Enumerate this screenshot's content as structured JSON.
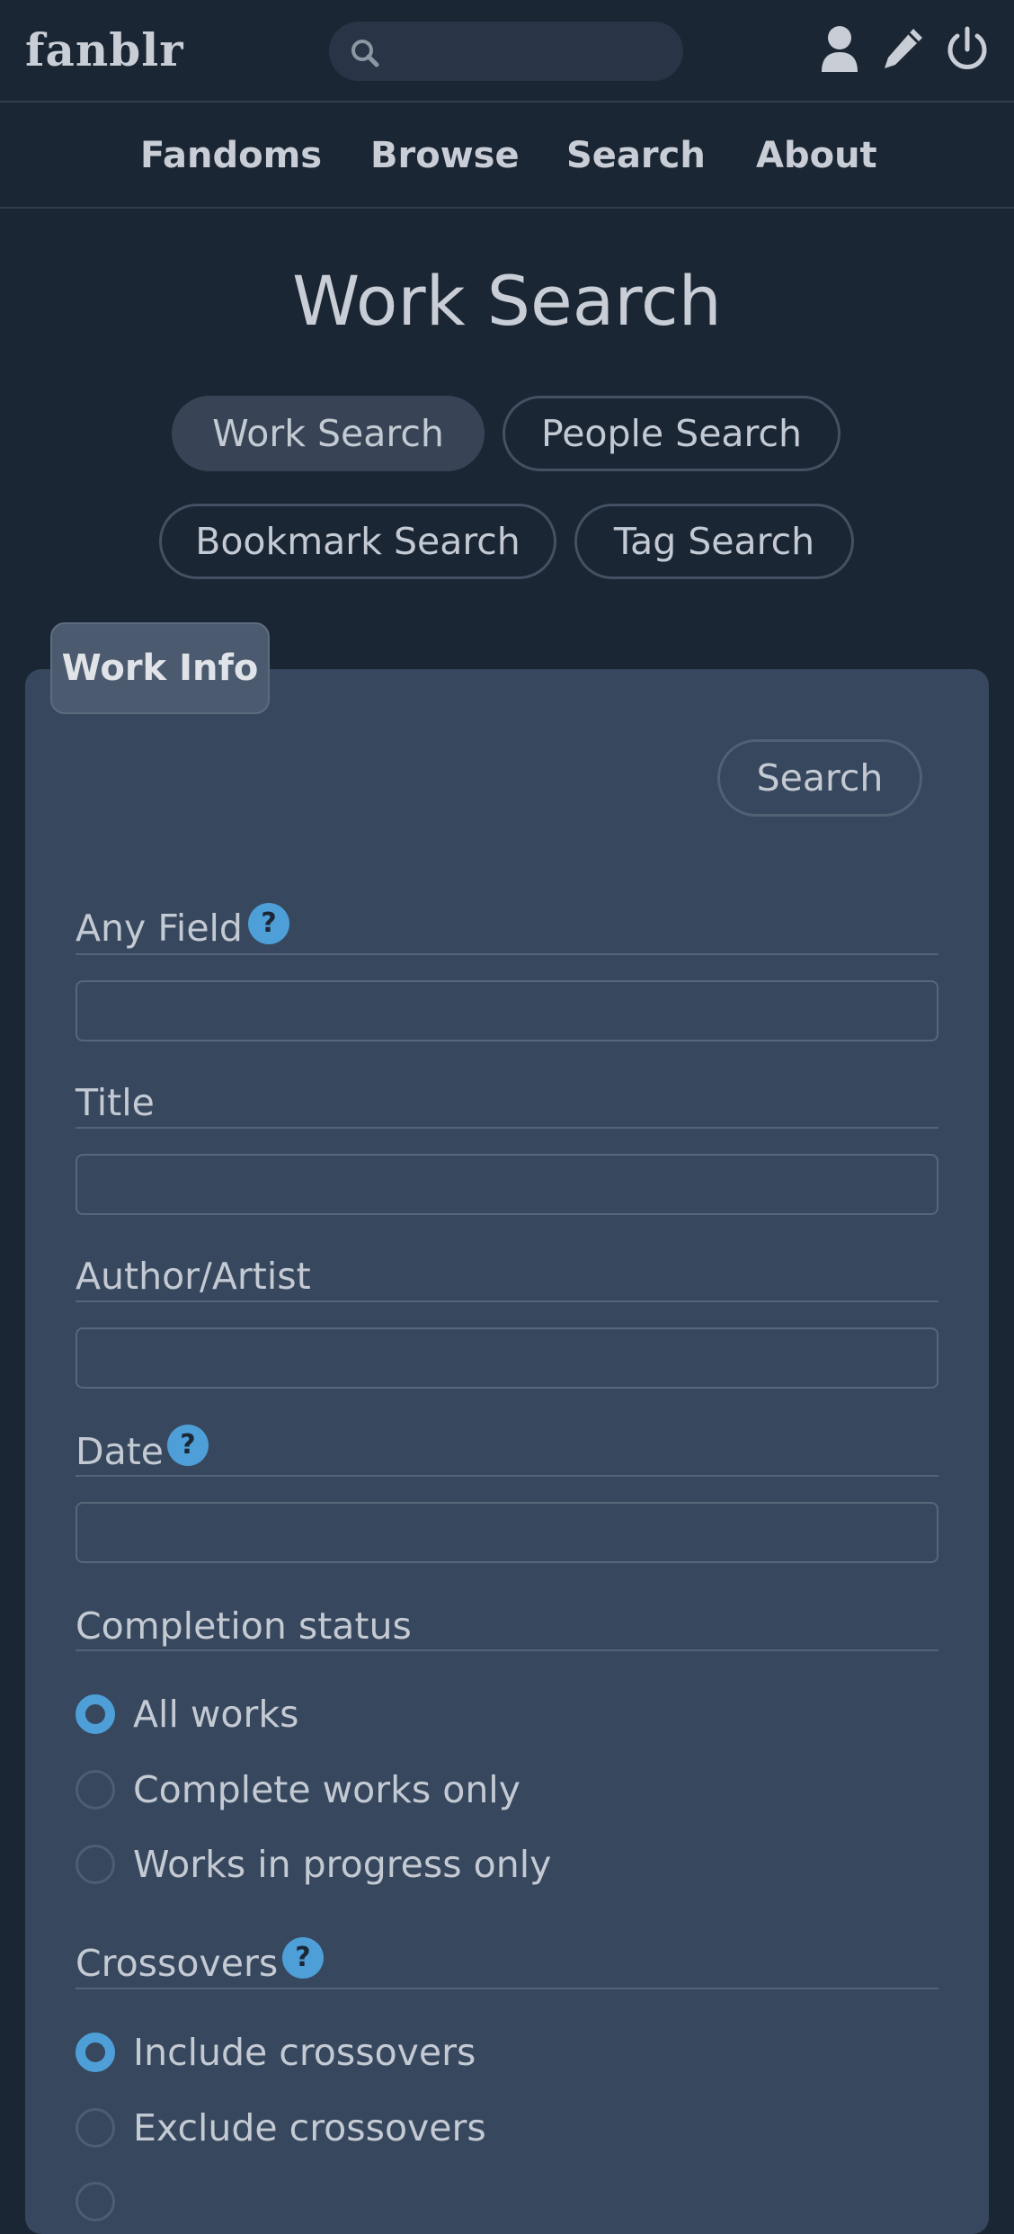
{
  "header": {
    "logo": "fanblr",
    "search": {
      "value": "",
      "placeholder": ""
    },
    "icons": [
      "user-icon",
      "pencil-icon",
      "power-icon"
    ]
  },
  "nav": {
    "items": [
      "Fandoms",
      "Browse",
      "Search",
      "About"
    ]
  },
  "page": {
    "title": "Work Search"
  },
  "search_types": [
    {
      "label": "Work Search",
      "active": true
    },
    {
      "label": "People Search",
      "active": false
    },
    {
      "label": "Bookmark Search",
      "active": false
    },
    {
      "label": "Tag Search",
      "active": false
    }
  ],
  "form": {
    "tab_label": "Work Info",
    "search_button": "Search",
    "fields": {
      "any_field": {
        "label": "Any Field",
        "value": "",
        "help": "?"
      },
      "title": {
        "label": "Title",
        "value": ""
      },
      "author": {
        "label": "Author/Artist",
        "value": ""
      },
      "date": {
        "label": "Date",
        "value": "",
        "help": "?"
      }
    },
    "completion": {
      "label": "Completion status",
      "options": [
        "All works",
        "Complete works only",
        "Works in progress only"
      ],
      "selected": "All works"
    },
    "crossovers": {
      "label": "Crossovers",
      "help": "?",
      "options": [
        "Include crossovers",
        "Exclude crossovers"
      ],
      "selected": "Include crossovers"
    }
  },
  "colors": {
    "background": "#1b2634",
    "panel": "#37475d",
    "accent": "#4e9fd8",
    "text": "#c4cad3"
  }
}
